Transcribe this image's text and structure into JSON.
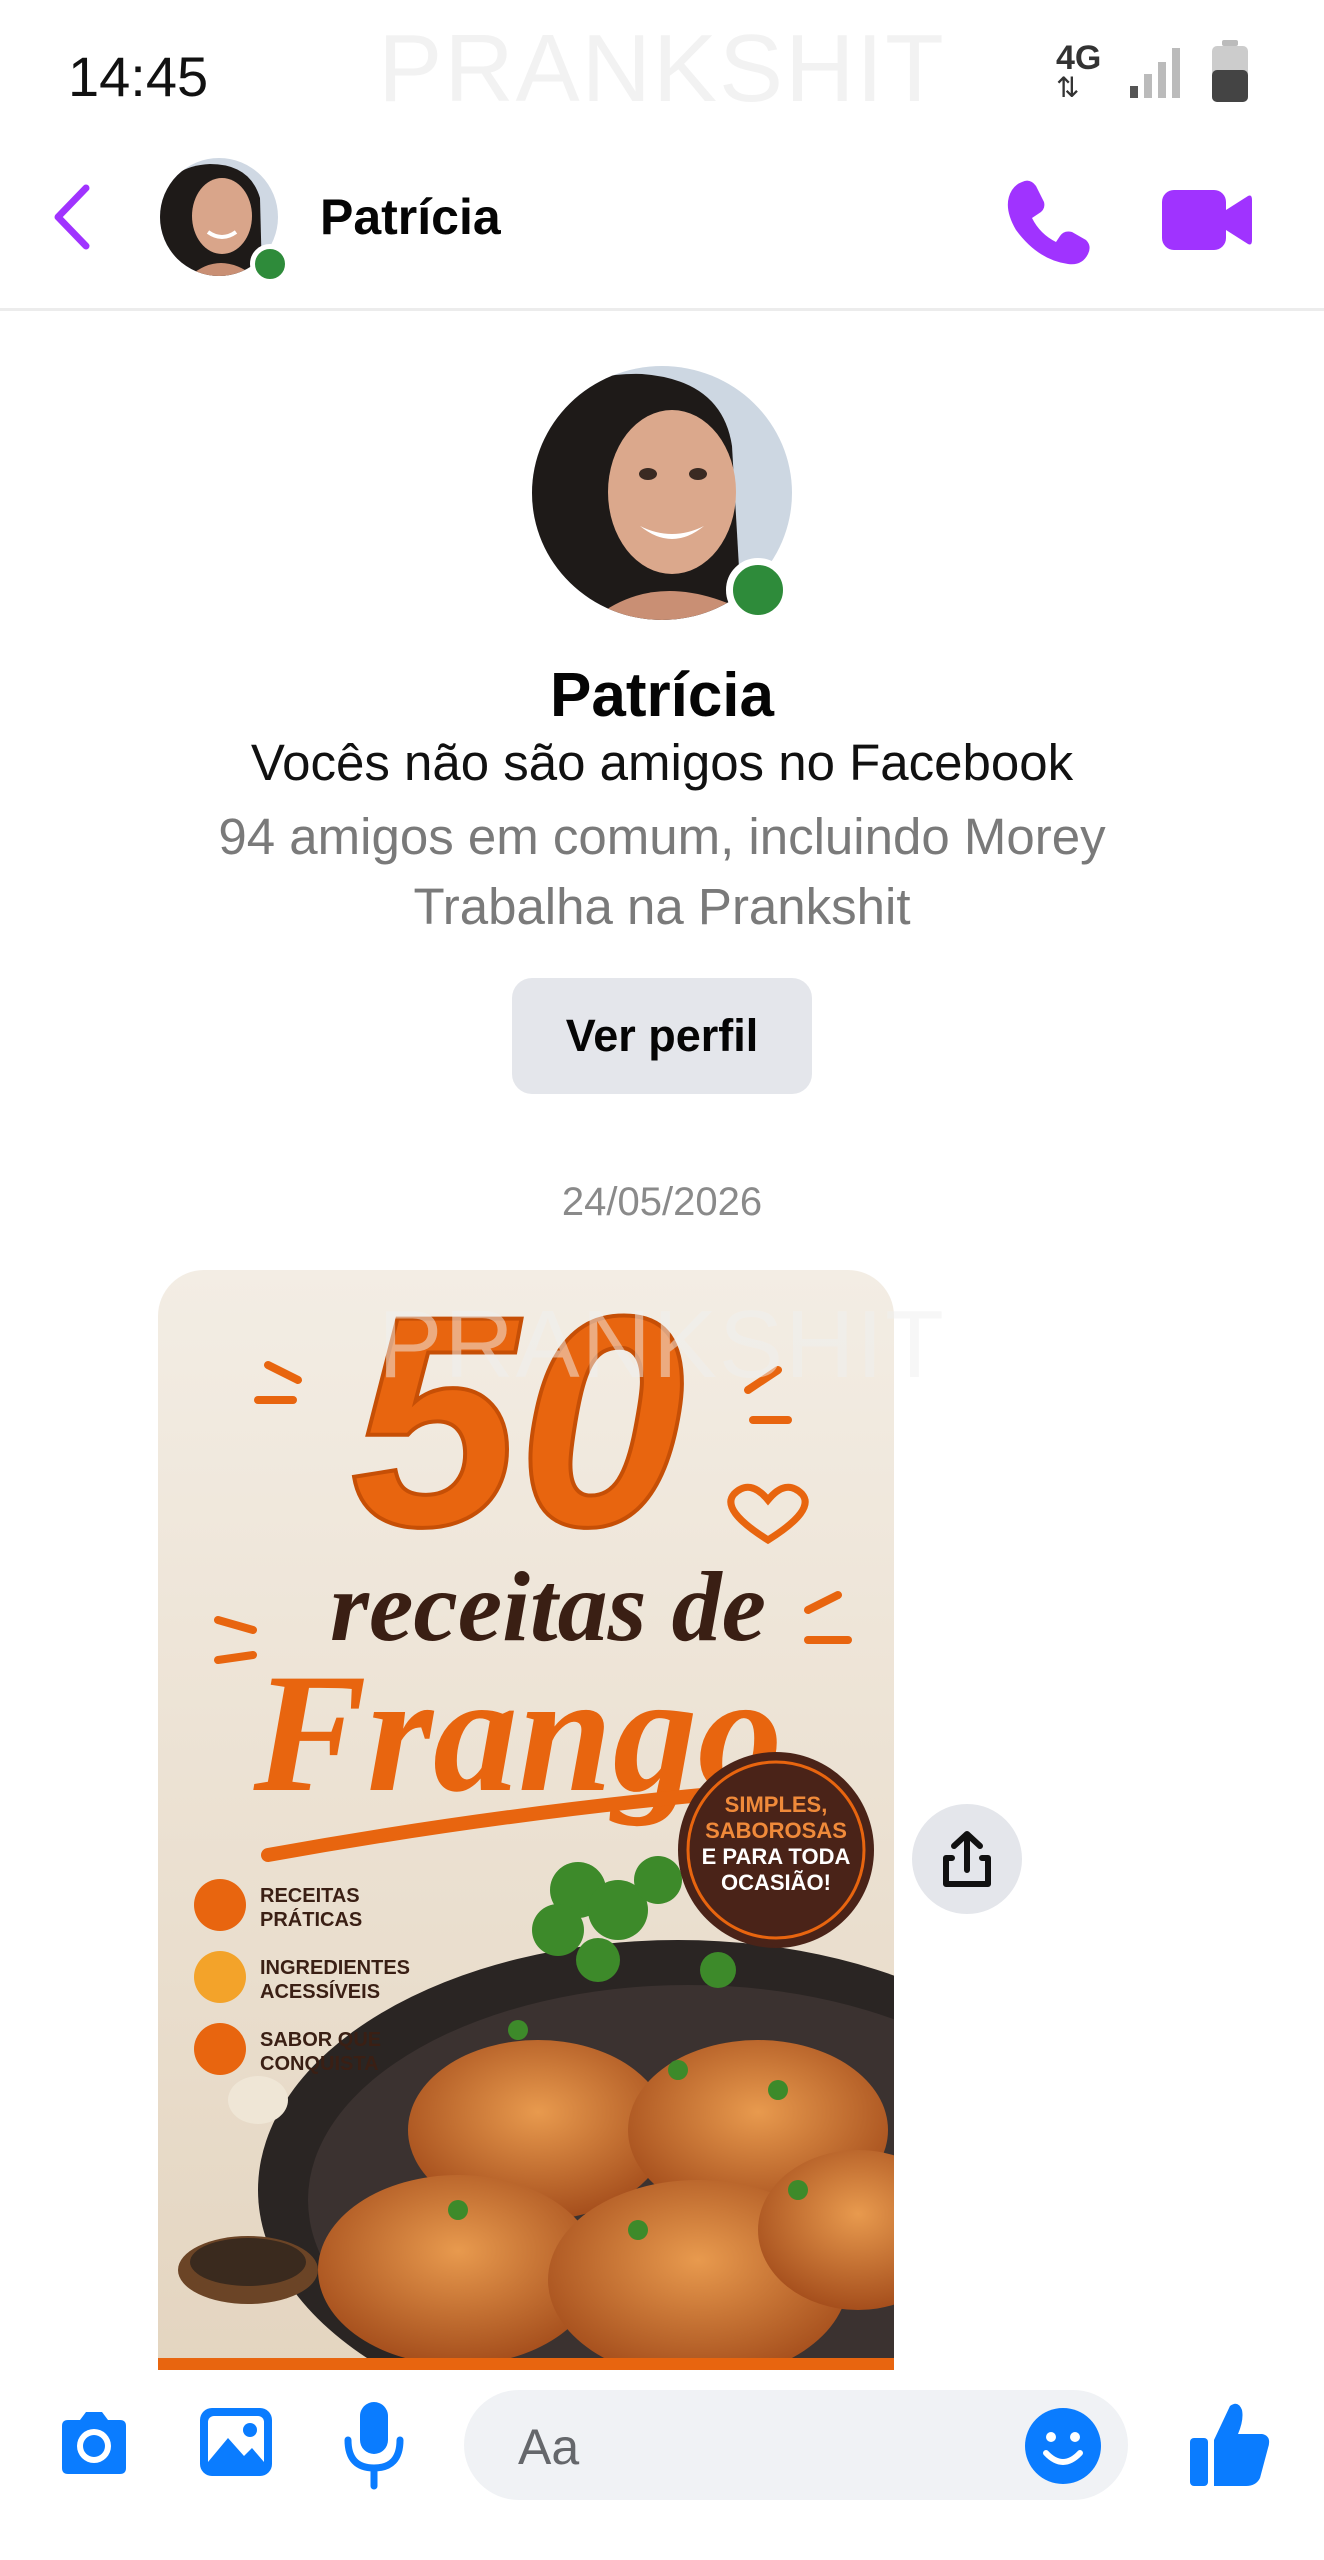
{
  "status_bar": {
    "time": "14:45",
    "network": "4G"
  },
  "watermark": "PRANKSHIT",
  "header": {
    "contact_name": "Patrícia",
    "online": true
  },
  "profile": {
    "name": "Patrícia",
    "relation": "Vocês não são amigos no Facebook",
    "mutual": "94 amigos em comum, incluindo Morey",
    "work": "Trabalha na Prankshit",
    "view_button": "Ver perfil"
  },
  "conversation": {
    "date": "24/05/2026"
  },
  "image_message": {
    "number": "50",
    "line1": "receitas de",
    "line2": "Frango",
    "badge": [
      "SIMPLES,",
      "SABOROSAS",
      "E PARA TODA",
      "OCASIÃO!"
    ],
    "features": [
      {
        "line1": "RECEITAS",
        "line2": "PRÁTICAS"
      },
      {
        "line1": "INGREDIENTES",
        "line2": "ACESSÍVEIS"
      },
      {
        "line1": "SABOR QUE",
        "line2": "CONQUISTA"
      }
    ]
  },
  "composer": {
    "placeholder": "Aa"
  },
  "colors": {
    "accent": "#a033ff",
    "blue": "#0a7cff",
    "orange": "#e8650f",
    "online": "#2e8b3a"
  }
}
